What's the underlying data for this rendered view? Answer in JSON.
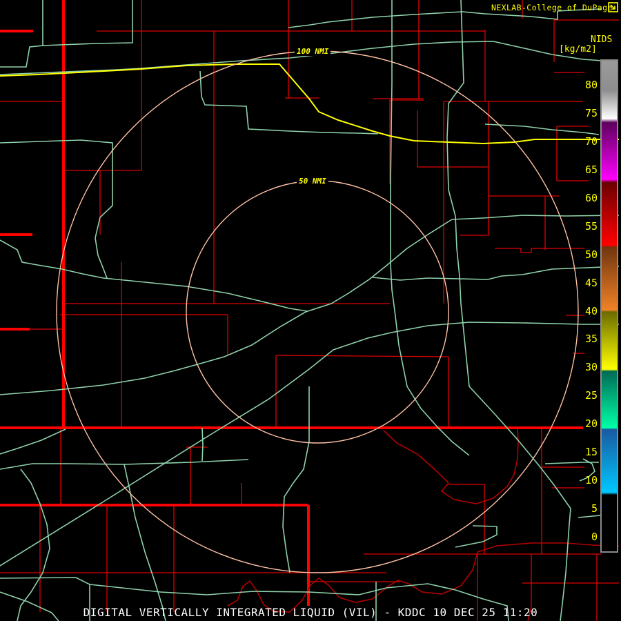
{
  "header": {
    "brand": "NEXLAB-College of DuPage",
    "brand_icon": "external-arrow-box-icon"
  },
  "legend": {
    "title": "NIDS",
    "units": "[kg/m2]",
    "ticks": [
      "80",
      "75",
      "70",
      "65",
      "60",
      "55",
      "50",
      "45",
      "40",
      "35",
      "30",
      "25",
      "20",
      "15",
      "10",
      "5",
      "0"
    ],
    "scale": {
      "min": 0,
      "max": 80,
      "step": 5,
      "gradient_stops": [
        [
          0.0,
          "#9a9a9a"
        ],
        [
          6.0,
          "#8e8e8e"
        ],
        [
          11.8,
          "#ffffff"
        ],
        [
          12.6,
          "#5c005c"
        ],
        [
          24.2,
          "#ff00ff"
        ],
        [
          24.8,
          "#6b0000"
        ],
        [
          37.6,
          "#ff0000"
        ],
        [
          38.0,
          "#70350e"
        ],
        [
          50.8,
          "#f08228"
        ],
        [
          51.2,
          "#6b6b00"
        ],
        [
          62.9,
          "#ffff00"
        ],
        [
          63.3,
          "#006b55"
        ],
        [
          74.8,
          "#00ffa6"
        ],
        [
          75.2,
          "#1a5aa0"
        ],
        [
          88.0,
          "#00c8ff"
        ],
        [
          88.5,
          "#000000"
        ],
        [
          100.0,
          "#000000"
        ]
      ]
    }
  },
  "map": {
    "ring_labels": [
      {
        "label": "100 NMI"
      },
      {
        "label": "50 NMI"
      }
    ],
    "range_rings_nmi": [
      50,
      100
    ],
    "radar_site": "KDDC"
  },
  "status_bar": {
    "caption": "DIGITAL VERTICALLY INTEGRATED LIQUID (VIL) - KDDC 10 DEC 25 11:20"
  },
  "colors": {
    "bg": "#000000",
    "county": "#e00000",
    "state": "#ff0000",
    "water": "#b40000",
    "road": "#8fd2ab",
    "highway": "#ffff00",
    "ring": "#ffc2a4",
    "accent_yellow": "#ffff00",
    "caption_color": "#ffffff",
    "legend_border": "#8a8a8a"
  }
}
